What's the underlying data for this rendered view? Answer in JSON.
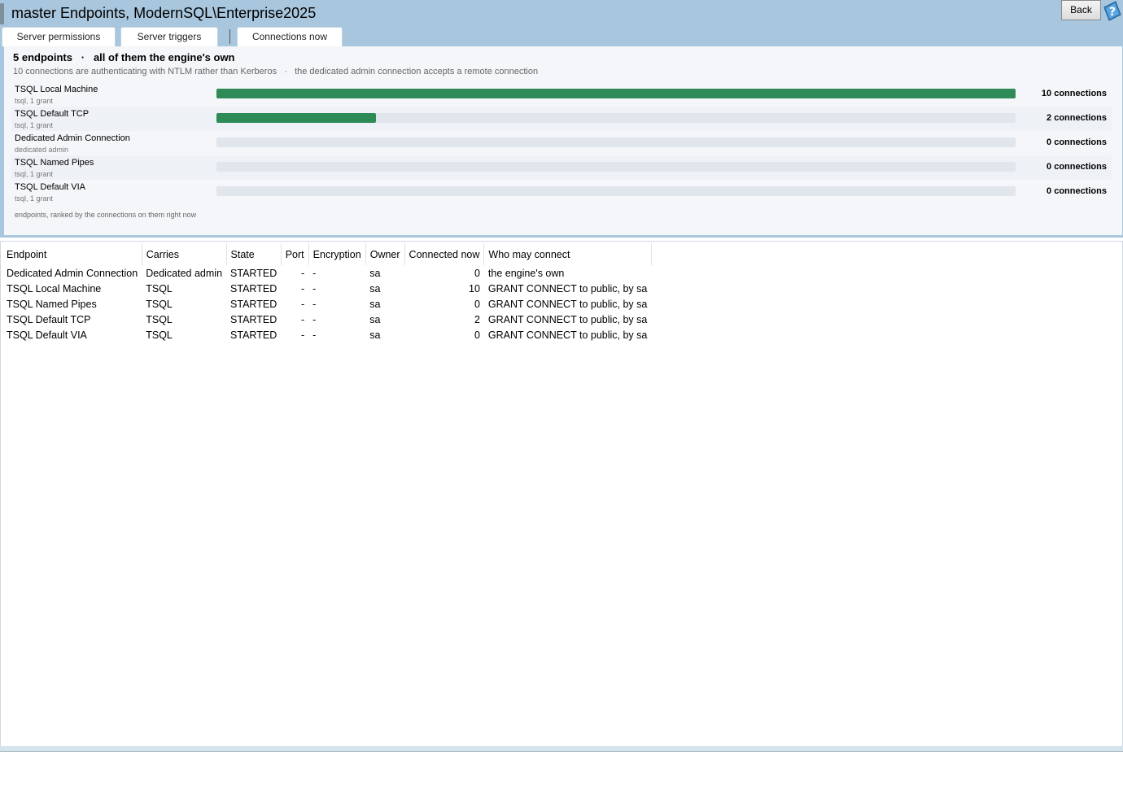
{
  "window": {
    "title": "master Endpoints, ModernSQL\\Enterprise2025",
    "back_label": "Back"
  },
  "tabs": [
    {
      "label": "Server permissions"
    },
    {
      "label": "Server triggers"
    },
    {
      "label": "Connections now"
    }
  ],
  "summary": {
    "headline": "5 endpoints   ·   all of them the engine's own",
    "detail": "10 connections are authenticating with NTLM rather than Kerberos   ·   the dedicated admin connection accepts a remote connection",
    "caption": "endpoints, ranked by the connections on them right now"
  },
  "chart_data": {
    "type": "bar",
    "orientation": "horizontal",
    "categories": [
      "TSQL Local Machine",
      "TSQL Default TCP",
      "Dedicated Admin Connection",
      "TSQL Named Pipes",
      "TSQL Default VIA"
    ],
    "subtitles": [
      "tsql, 1 grant",
      "tsql, 1 grant",
      "dedicated admin",
      "tsql, 1 grant",
      "tsql, 1 grant"
    ],
    "values": [
      10,
      2,
      0,
      0,
      0
    ],
    "value_labels": [
      "10 connections",
      "2 connections",
      "0 connections",
      "0 connections",
      "0 connections"
    ],
    "xlim": [
      0,
      10
    ],
    "bar_color": "#2e8b57",
    "track_color": "#e1e6ed"
  },
  "grid": {
    "columns": [
      "Endpoint",
      "Carries",
      "State",
      "Port",
      "Encryption",
      "Owner",
      "Connected now",
      "Who may connect"
    ],
    "rows": [
      [
        "Dedicated Admin Connection",
        "Dedicated admin",
        "STARTED",
        "-",
        "-",
        "sa",
        "0",
        "the engine's own"
      ],
      [
        "TSQL Local Machine",
        "TSQL",
        "STARTED",
        "-",
        "-",
        "sa",
        "10",
        "GRANT CONNECT to public, by sa"
      ],
      [
        "TSQL Named Pipes",
        "TSQL",
        "STARTED",
        "-",
        "-",
        "sa",
        "0",
        "GRANT CONNECT to public, by sa"
      ],
      [
        "TSQL Default TCP",
        "TSQL",
        "STARTED",
        "-",
        "-",
        "sa",
        "2",
        "GRANT CONNECT to public, by sa"
      ],
      [
        "TSQL Default VIA",
        "TSQL",
        "STARTED",
        "-",
        "-",
        "sa",
        "0",
        "GRANT CONNECT to public, by sa"
      ]
    ]
  },
  "colors": {
    "header_bg": "#a8c6dd",
    "accent_green": "#2e8b57"
  }
}
